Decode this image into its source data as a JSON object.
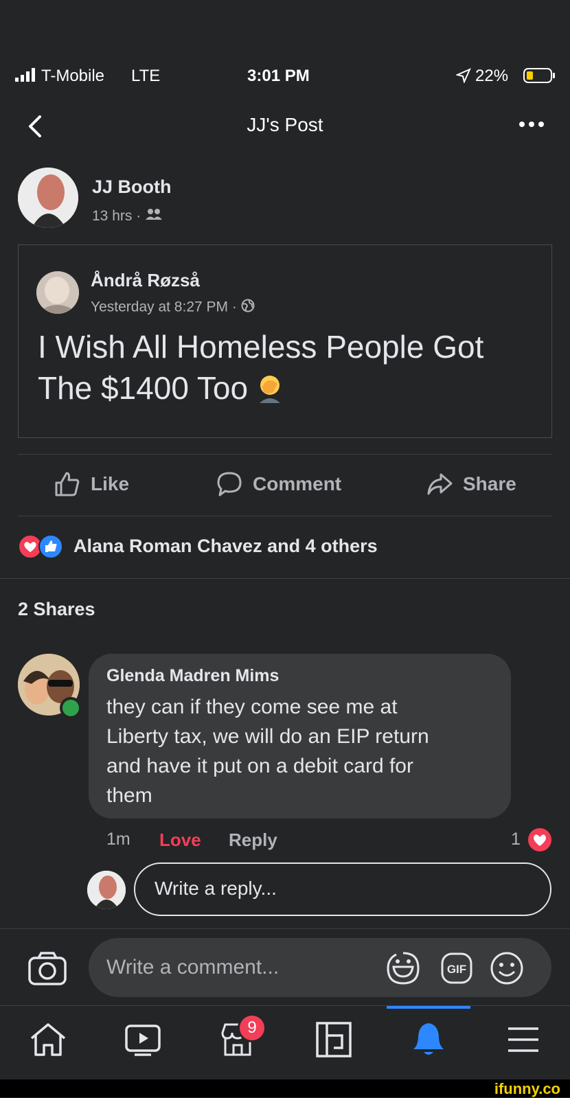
{
  "status_bar": {
    "carrier": "T-Mobile",
    "network": "LTE",
    "time": "3:01 PM",
    "battery": "22%"
  },
  "header": {
    "title": "JJ's Post"
  },
  "post": {
    "author": "JJ Booth",
    "time": "13 hrs",
    "shared": {
      "author": "Åndrå Røzså",
      "time": "Yesterday at 8:27 PM",
      "text_line1": "I Wish All Homeless People Got",
      "text_line2": "The $1400 Too"
    }
  },
  "actions": {
    "like": "Like",
    "comment": "Comment",
    "share": "Share"
  },
  "reactions": {
    "text": "Alana Roman Chavez and 4 others"
  },
  "shares": {
    "text": "2 Shares"
  },
  "comment": {
    "author": "Glenda Madren Mims",
    "lines": [
      "they can if they come see me at",
      "Liberty tax, we will do an EIP return",
      "and have it put on a debit card for",
      "them"
    ],
    "time": "1m",
    "love": "Love",
    "reply": "Reply",
    "reaction_count": "1"
  },
  "reply_input": {
    "placeholder": "Write a reply..."
  },
  "comment_input": {
    "placeholder": "Write a comment..."
  },
  "tabbar": {
    "marketplace_badge": "9"
  },
  "watermark": {
    "text": "ifunny.co"
  },
  "colors": {
    "background": "#242526",
    "accent": "#2d88ff",
    "love": "#f33e58",
    "online": "#31a24c"
  }
}
